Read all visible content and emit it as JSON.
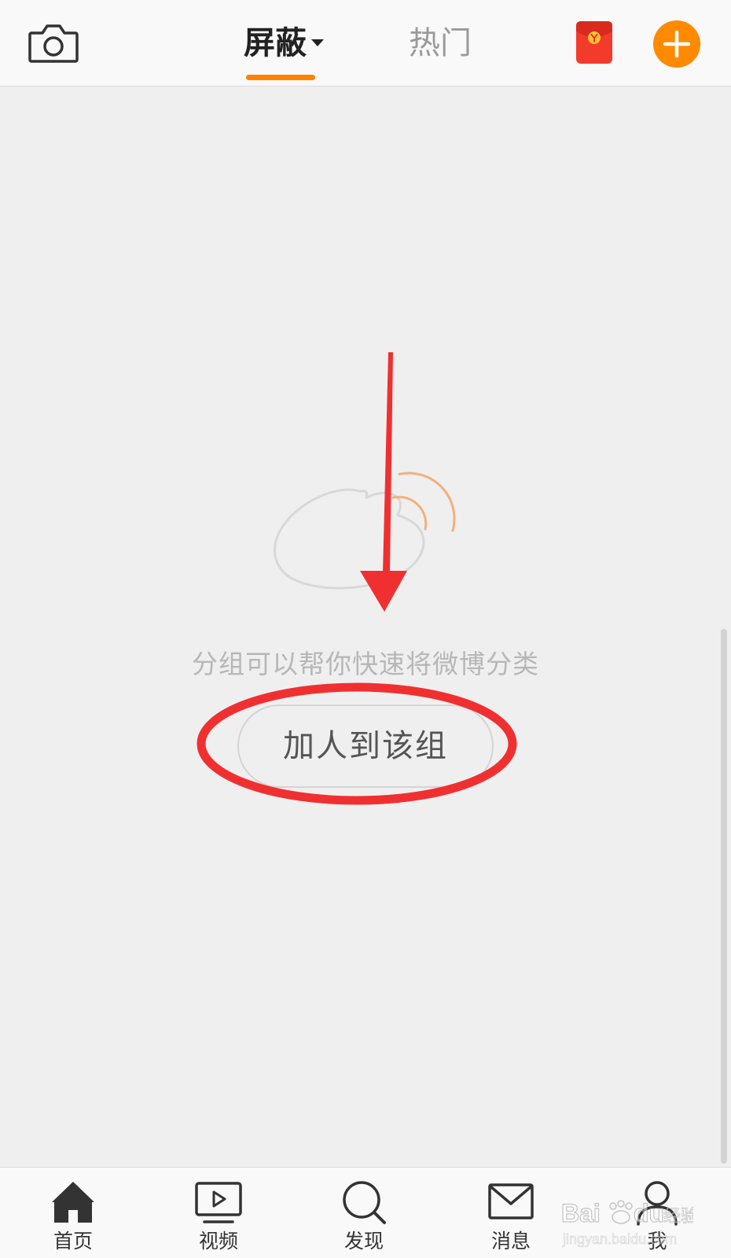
{
  "header": {
    "tabs": [
      {
        "label": "屏蔽",
        "active": true
      },
      {
        "label": "热门",
        "active": false
      }
    ],
    "accent_color": "#ff8200",
    "icons": [
      "camera-icon",
      "red-packet-icon",
      "plus-icon"
    ]
  },
  "empty_state": {
    "hint": "分组可以帮你快速将微博分类",
    "button_label": "加人到该组",
    "illustration": "weibo-logo-icon"
  },
  "bottom_nav": {
    "items": [
      {
        "label": "首页",
        "icon": "home-icon"
      },
      {
        "label": "视频",
        "icon": "video-icon"
      },
      {
        "label": "发现",
        "icon": "search-icon"
      },
      {
        "label": "消息",
        "icon": "mail-icon"
      },
      {
        "label": "我",
        "icon": "user-icon"
      }
    ]
  },
  "annotation_color": "#f03030",
  "watermark": "Baidu经验 jingyan.baidu.com"
}
